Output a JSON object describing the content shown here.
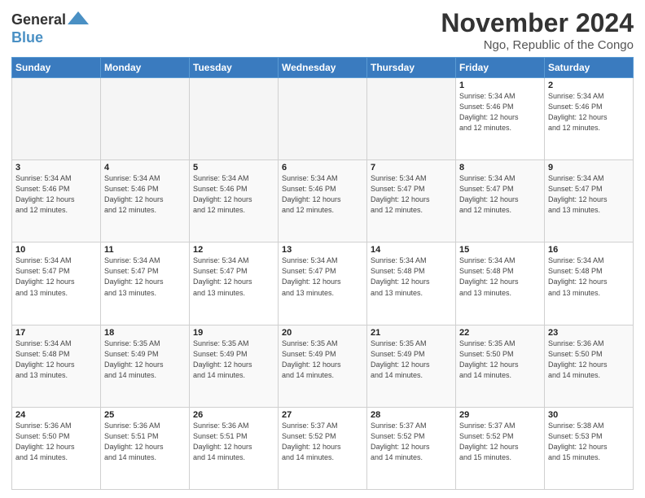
{
  "header": {
    "logo_line1": "General",
    "logo_line2": "Blue",
    "month": "November 2024",
    "location": "Ngo, Republic of the Congo"
  },
  "days_of_week": [
    "Sunday",
    "Monday",
    "Tuesday",
    "Wednesday",
    "Thursday",
    "Friday",
    "Saturday"
  ],
  "weeks": [
    [
      {
        "day": "",
        "detail": ""
      },
      {
        "day": "",
        "detail": ""
      },
      {
        "day": "",
        "detail": ""
      },
      {
        "day": "",
        "detail": ""
      },
      {
        "day": "",
        "detail": ""
      },
      {
        "day": "1",
        "detail": "Sunrise: 5:34 AM\nSunset: 5:46 PM\nDaylight: 12 hours\nand 12 minutes."
      },
      {
        "day": "2",
        "detail": "Sunrise: 5:34 AM\nSunset: 5:46 PM\nDaylight: 12 hours\nand 12 minutes."
      }
    ],
    [
      {
        "day": "3",
        "detail": "Sunrise: 5:34 AM\nSunset: 5:46 PM\nDaylight: 12 hours\nand 12 minutes."
      },
      {
        "day": "4",
        "detail": "Sunrise: 5:34 AM\nSunset: 5:46 PM\nDaylight: 12 hours\nand 12 minutes."
      },
      {
        "day": "5",
        "detail": "Sunrise: 5:34 AM\nSunset: 5:46 PM\nDaylight: 12 hours\nand 12 minutes."
      },
      {
        "day": "6",
        "detail": "Sunrise: 5:34 AM\nSunset: 5:46 PM\nDaylight: 12 hours\nand 12 minutes."
      },
      {
        "day": "7",
        "detail": "Sunrise: 5:34 AM\nSunset: 5:47 PM\nDaylight: 12 hours\nand 12 minutes."
      },
      {
        "day": "8",
        "detail": "Sunrise: 5:34 AM\nSunset: 5:47 PM\nDaylight: 12 hours\nand 12 minutes."
      },
      {
        "day": "9",
        "detail": "Sunrise: 5:34 AM\nSunset: 5:47 PM\nDaylight: 12 hours\nand 13 minutes."
      }
    ],
    [
      {
        "day": "10",
        "detail": "Sunrise: 5:34 AM\nSunset: 5:47 PM\nDaylight: 12 hours\nand 13 minutes."
      },
      {
        "day": "11",
        "detail": "Sunrise: 5:34 AM\nSunset: 5:47 PM\nDaylight: 12 hours\nand 13 minutes."
      },
      {
        "day": "12",
        "detail": "Sunrise: 5:34 AM\nSunset: 5:47 PM\nDaylight: 12 hours\nand 13 minutes."
      },
      {
        "day": "13",
        "detail": "Sunrise: 5:34 AM\nSunset: 5:47 PM\nDaylight: 12 hours\nand 13 minutes."
      },
      {
        "day": "14",
        "detail": "Sunrise: 5:34 AM\nSunset: 5:48 PM\nDaylight: 12 hours\nand 13 minutes."
      },
      {
        "day": "15",
        "detail": "Sunrise: 5:34 AM\nSunset: 5:48 PM\nDaylight: 12 hours\nand 13 minutes."
      },
      {
        "day": "16",
        "detail": "Sunrise: 5:34 AM\nSunset: 5:48 PM\nDaylight: 12 hours\nand 13 minutes."
      }
    ],
    [
      {
        "day": "17",
        "detail": "Sunrise: 5:34 AM\nSunset: 5:48 PM\nDaylight: 12 hours\nand 13 minutes."
      },
      {
        "day": "18",
        "detail": "Sunrise: 5:35 AM\nSunset: 5:49 PM\nDaylight: 12 hours\nand 14 minutes."
      },
      {
        "day": "19",
        "detail": "Sunrise: 5:35 AM\nSunset: 5:49 PM\nDaylight: 12 hours\nand 14 minutes."
      },
      {
        "day": "20",
        "detail": "Sunrise: 5:35 AM\nSunset: 5:49 PM\nDaylight: 12 hours\nand 14 minutes."
      },
      {
        "day": "21",
        "detail": "Sunrise: 5:35 AM\nSunset: 5:49 PM\nDaylight: 12 hours\nand 14 minutes."
      },
      {
        "day": "22",
        "detail": "Sunrise: 5:35 AM\nSunset: 5:50 PM\nDaylight: 12 hours\nand 14 minutes."
      },
      {
        "day": "23",
        "detail": "Sunrise: 5:36 AM\nSunset: 5:50 PM\nDaylight: 12 hours\nand 14 minutes."
      }
    ],
    [
      {
        "day": "24",
        "detail": "Sunrise: 5:36 AM\nSunset: 5:50 PM\nDaylight: 12 hours\nand 14 minutes."
      },
      {
        "day": "25",
        "detail": "Sunrise: 5:36 AM\nSunset: 5:51 PM\nDaylight: 12 hours\nand 14 minutes."
      },
      {
        "day": "26",
        "detail": "Sunrise: 5:36 AM\nSunset: 5:51 PM\nDaylight: 12 hours\nand 14 minutes."
      },
      {
        "day": "27",
        "detail": "Sunrise: 5:37 AM\nSunset: 5:52 PM\nDaylight: 12 hours\nand 14 minutes."
      },
      {
        "day": "28",
        "detail": "Sunrise: 5:37 AM\nSunset: 5:52 PM\nDaylight: 12 hours\nand 14 minutes."
      },
      {
        "day": "29",
        "detail": "Sunrise: 5:37 AM\nSunset: 5:52 PM\nDaylight: 12 hours\nand 15 minutes."
      },
      {
        "day": "30",
        "detail": "Sunrise: 5:38 AM\nSunset: 5:53 PM\nDaylight: 12 hours\nand 15 minutes."
      }
    ]
  ]
}
